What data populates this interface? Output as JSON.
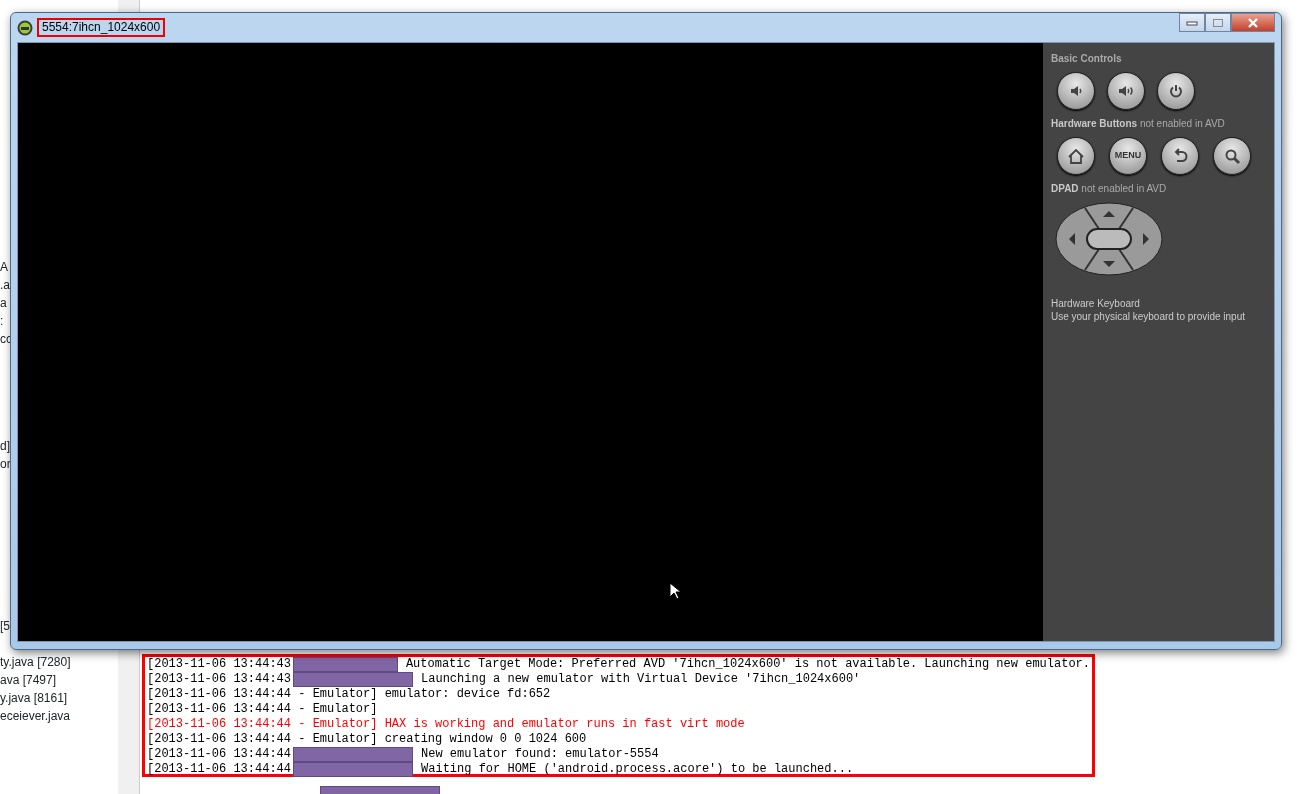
{
  "sidebar": {
    "groups": [
      [
        "A",
        ".a",
        "a",
        ":",
        "cc"
      ],
      [
        "d]",
        "or"
      ],
      [
        "[5"
      ],
      [
        "ty.java [7280]",
        "ava [7497]",
        "y.java [8161]",
        "eceiever.java"
      ]
    ]
  },
  "console": {
    "lines": [
      {
        "kind": "redacted",
        "error": false,
        "timestamp": "[2013-11-06 13:44:43",
        "message": "Automatic Target Mode: Preferred AVD '7ihcn_1024x600' is not available. Launching new emulator."
      },
      {
        "kind": "redacted",
        "error": false,
        "timestamp": "[2013-11-06 13:44:43",
        "message": "Launching a new emulator with Virtual Device '7ihcn_1024x600'"
      },
      {
        "kind": "plain",
        "error": false,
        "text": "[2013-11-06 13:44:44 - Emulator] emulator: device fd:652"
      },
      {
        "kind": "plain",
        "error": false,
        "text": "[2013-11-06 13:44:44 - Emulator]"
      },
      {
        "kind": "plain",
        "error": true,
        "text": "[2013-11-06 13:44:44 - Emulator] HAX is working and emulator runs in fast virt mode"
      },
      {
        "kind": "plain",
        "error": false,
        "text": "[2013-11-06 13:44:44 - Emulator] creating window 0 0 1024 600"
      },
      {
        "kind": "redacted",
        "error": false,
        "timestamp": "[2013-11-06 13:44:44",
        "message": "New emulator found: emulator-5554"
      },
      {
        "kind": "redacted",
        "error": false,
        "timestamp": "[2013-11-06 13:44:44",
        "message": "Waiting for HOME ('android.process.acore') to be launched..."
      }
    ]
  },
  "emulator": {
    "window": {
      "title": "5554:7ihcn_1024x600"
    },
    "panel": {
      "sections": [
        {
          "kind": "buttons",
          "heading": "Basic Controls",
          "buttons": [
            {
              "kind": "volume-down"
            },
            {
              "kind": "volume-up"
            },
            {
              "kind": "power"
            }
          ]
        },
        {
          "kind": "buttons",
          "heading": "**Hardware Buttons** not enabled in AVD",
          "buttons": [
            {
              "kind": "home"
            },
            {
              "kind": "menu",
              "label": "MENU"
            },
            {
              "kind": "back"
            },
            {
              "kind": "search"
            }
          ]
        },
        {
          "kind": "dpad",
          "heading": "**DPAD** not enabled in AVD"
        },
        {
          "kind": "text",
          "heading": "Hardware Keyboard",
          "text": "Use your physical keyboard to provide input"
        }
      ]
    }
  }
}
